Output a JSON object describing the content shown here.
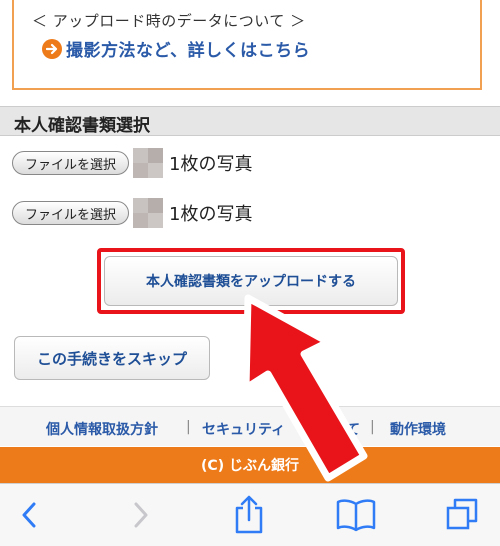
{
  "info_box": {
    "line1": "＜ アップロード時のデータについて ＞",
    "link": "撮影方法など、詳しくはこちら"
  },
  "section": {
    "title": "本人確認書類選択"
  },
  "file_rows": [
    {
      "button": "ファイルを選択",
      "count": "1枚の写真"
    },
    {
      "button": "ファイルを選択",
      "count": "1枚の写真"
    }
  ],
  "upload_button": "本人確認書類をアップロードする",
  "skip_button": "この手続きをスキップ",
  "footer": {
    "link1": "個人情報取扱方針",
    "separator": "|",
    "link2": "セキュリティ",
    "link2_tail": "て",
    "link3": "動作環境"
  },
  "copyright": "(C) じぶん銀行",
  "colors": {
    "accent_orange": "#ee7b1a",
    "highlight_red": "#e8141a",
    "link_blue": "#2a5aa8"
  },
  "toolbar_icons": [
    "back-icon",
    "forward-icon",
    "share-icon",
    "bookmarks-icon",
    "tabs-icon"
  ]
}
